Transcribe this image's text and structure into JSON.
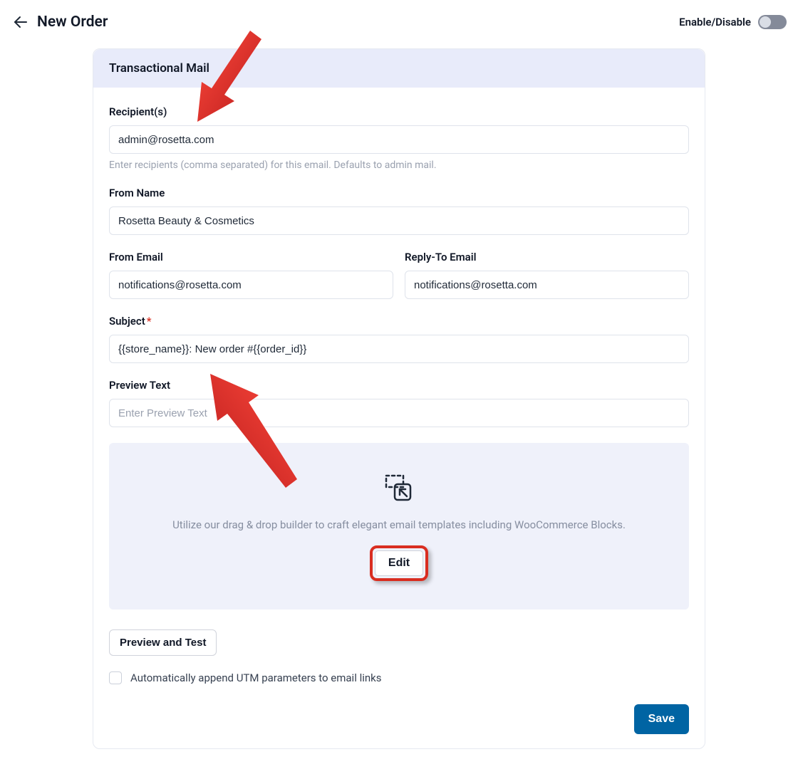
{
  "header": {
    "title": "New Order",
    "enable_label": "Enable/Disable"
  },
  "card": {
    "title": "Transactional Mail",
    "recipients": {
      "label": "Recipient(s)",
      "value": "admin@rosetta.com",
      "help": "Enter recipients (comma separated) for this email. Defaults to admin mail."
    },
    "from_name": {
      "label": "From Name",
      "value": "Rosetta Beauty & Cosmetics"
    },
    "from_email": {
      "label": "From Email",
      "value": "notifications@rosetta.com"
    },
    "reply_to": {
      "label": "Reply-To Email",
      "value": "notifications@rosetta.com"
    },
    "subject": {
      "label": "Subject",
      "value": "{{store_name}}: New order #{{order_id}}"
    },
    "preview_text": {
      "label": "Preview Text",
      "placeholder": "Enter Preview Text",
      "value": ""
    },
    "builder": {
      "text": "Utilize our drag & drop builder to craft elegant email templates including WooCommerce Blocks.",
      "edit_label": "Edit"
    },
    "preview_test_label": "Preview and Test",
    "utm_label": "Automatically append UTM parameters to email links",
    "save_label": "Save"
  }
}
